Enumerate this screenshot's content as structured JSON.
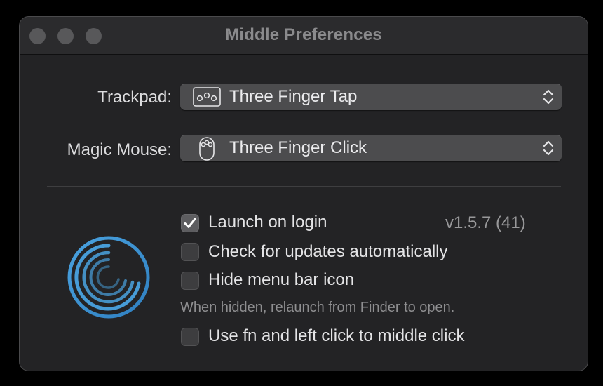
{
  "window": {
    "title": "Middle Preferences"
  },
  "trackpad": {
    "label": "Trackpad:",
    "selected": "Three Finger Tap",
    "icon": "trackpad-three-finger-icon"
  },
  "magic_mouse": {
    "label": "Magic Mouse:",
    "selected": "Three Finger Click",
    "icon": "magic-mouse-icon"
  },
  "options": {
    "launch_on_login": {
      "label": "Launch on login",
      "checked": true
    },
    "check_updates": {
      "label": "Check for updates automatically",
      "checked": false
    },
    "hide_menu_bar": {
      "label": "Hide menu bar icon",
      "checked": false
    },
    "hide_hint": "When hidden, relaunch from Finder to open.",
    "fn_left_click": {
      "label": "Use fn and left click to middle click",
      "checked": false
    }
  },
  "version": "v1.5.7 (41)",
  "colors": {
    "logo_accent": "#4aa3e0",
    "window_bg": "#232325",
    "popup_bg": "#4c4c4e"
  }
}
